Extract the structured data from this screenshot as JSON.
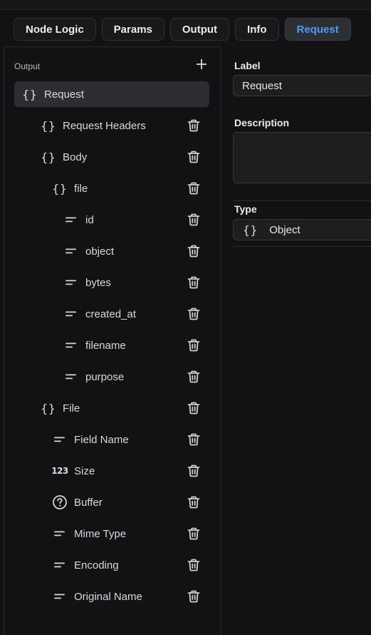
{
  "tabs": [
    {
      "label": "Node Logic",
      "active": false
    },
    {
      "label": "Params",
      "active": false
    },
    {
      "label": "Output",
      "active": false
    },
    {
      "label": "Info",
      "active": false
    },
    {
      "label": "Request",
      "active": true
    }
  ],
  "output": {
    "header_label": "Output",
    "items": [
      {
        "label": "Request",
        "icon": "object-braces-icon",
        "depth": 0,
        "selected": true
      },
      {
        "label": "Request Headers",
        "icon": "object-braces-icon",
        "depth": 1
      },
      {
        "label": "Body",
        "icon": "object-braces-icon",
        "depth": 1
      },
      {
        "label": "file",
        "icon": "object-braces-icon",
        "depth": 2
      },
      {
        "label": "id",
        "icon": "text-lines-icon",
        "depth": 3
      },
      {
        "label": "object",
        "icon": "text-lines-icon",
        "depth": 3
      },
      {
        "label": "bytes",
        "icon": "text-lines-icon",
        "depth": 3
      },
      {
        "label": "created_at",
        "icon": "text-lines-icon",
        "depth": 3
      },
      {
        "label": "filename",
        "icon": "text-lines-icon",
        "depth": 3
      },
      {
        "label": "purpose",
        "icon": "text-lines-icon",
        "depth": 3
      },
      {
        "label": "File",
        "icon": "object-braces-icon",
        "depth": 1
      },
      {
        "label": "Field Name",
        "icon": "text-lines-icon",
        "depth": 2
      },
      {
        "label": "Size",
        "icon": "number-icon",
        "depth": 2
      },
      {
        "label": "Buffer",
        "icon": "question-circle-icon",
        "depth": 2
      },
      {
        "label": "Mime Type",
        "icon": "text-lines-icon",
        "depth": 2
      },
      {
        "label": "Encoding",
        "icon": "text-lines-icon",
        "depth": 2
      },
      {
        "label": "Original Name",
        "icon": "text-lines-icon",
        "depth": 2
      }
    ]
  },
  "details": {
    "label_title": "Label",
    "label_value": "Request",
    "description_title": "Description",
    "description_value": "",
    "type_title": "Type",
    "type_value": "Object",
    "type_icon": "object-braces-icon"
  },
  "icon_glyphs": {
    "object_braces": "{}",
    "number": "123"
  },
  "colors": {
    "accent": "#4d9bf7",
    "background": "#121214",
    "selected_row": "#2e2e32"
  }
}
